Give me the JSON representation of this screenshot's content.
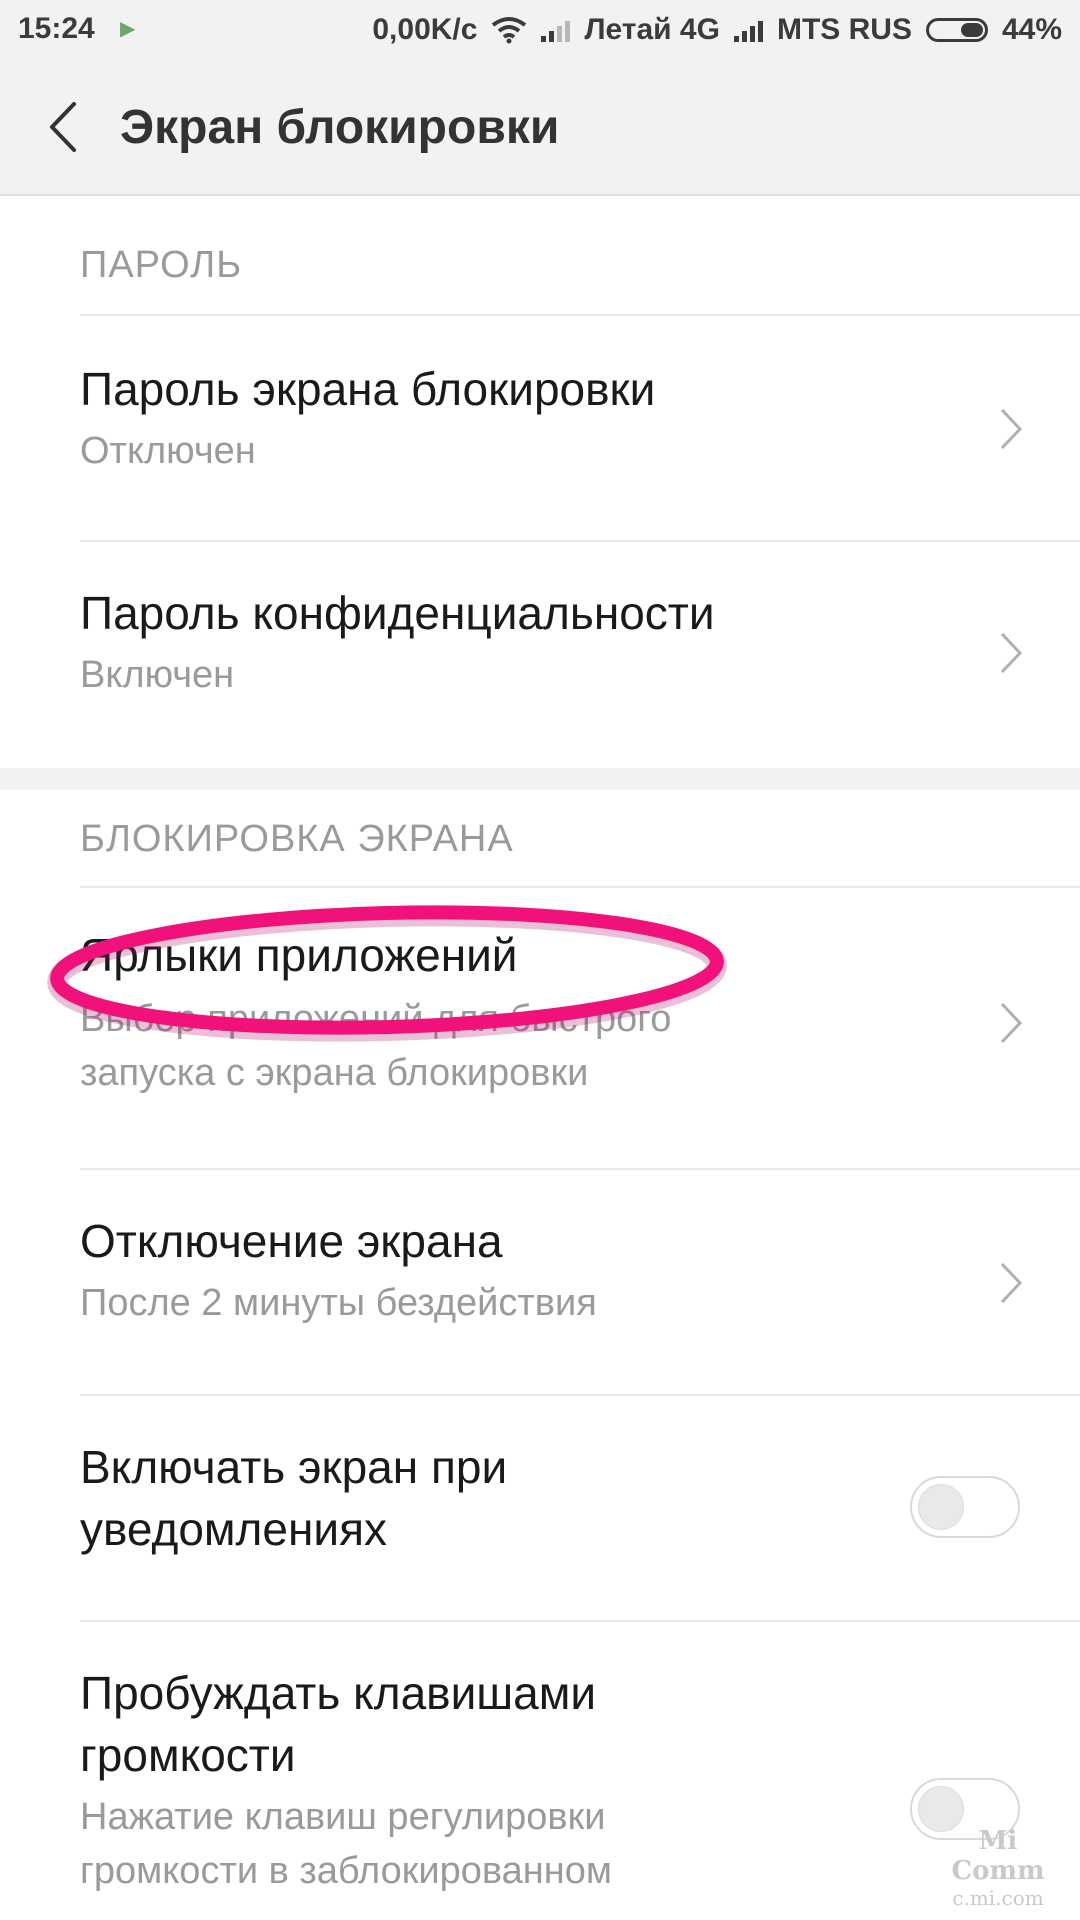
{
  "status_bar": {
    "time": "15:24",
    "speed": "0,00K/с",
    "carrier1": "Летай 4G",
    "carrier2": "MTS RUS",
    "battery": "44%",
    "battery_level": 0.44
  },
  "header": {
    "title": "Экран блокировки"
  },
  "sections": [
    {
      "title": "ПАРОЛЬ",
      "items": [
        {
          "title": "Пароль экрана блокировки",
          "subtitle": "Отключен"
        },
        {
          "title": "Пароль конфиденциальности",
          "subtitle": "Включен"
        }
      ]
    },
    {
      "title": "БЛОКИРОВКА ЭКРАНА",
      "items": [
        {
          "title": "Ярлыки приложений",
          "subtitle_line1": "Выбор приложений для быстрого",
          "subtitle_line2": "запуска с экрана блокировки"
        },
        {
          "title": "Отключение экрана",
          "subtitle": "После 2 минуты бездействия"
        },
        {
          "title_line1": "Включать экран при",
          "title_line2": "уведомлениях",
          "toggle_on": false
        },
        {
          "title_line1": "Пробуждать клавишами",
          "title_line2": "громкости",
          "subtitle_line1": "Нажатие клавиш регулировки",
          "subtitle_line2": "громкости в заблокированном",
          "toggle_on": false
        }
      ]
    }
  ],
  "watermark": {
    "line1": "Mi Comm",
    "line2": "c.mi.com"
  },
  "colors": {
    "annotation": "#f0127a",
    "header_bg": "#f2f2f2",
    "secondary_text": "#9a9a9a"
  }
}
